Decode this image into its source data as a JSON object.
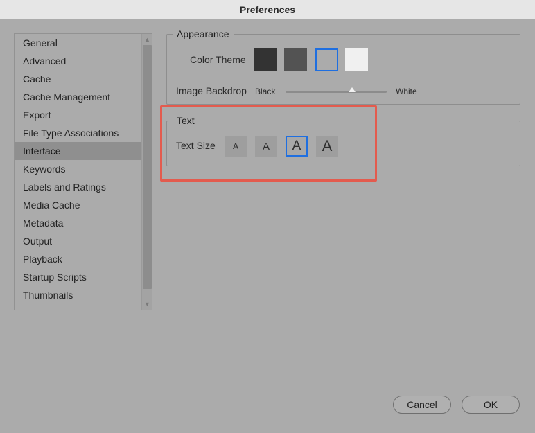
{
  "window": {
    "title": "Preferences"
  },
  "sidebar": {
    "items": [
      {
        "label": "General"
      },
      {
        "label": "Advanced"
      },
      {
        "label": "Cache"
      },
      {
        "label": "Cache Management"
      },
      {
        "label": "Export"
      },
      {
        "label": "File Type Associations"
      },
      {
        "label": "Interface",
        "selected": true
      },
      {
        "label": "Keywords"
      },
      {
        "label": "Labels and Ratings"
      },
      {
        "label": "Media Cache"
      },
      {
        "label": "Metadata"
      },
      {
        "label": "Output"
      },
      {
        "label": "Playback"
      },
      {
        "label": "Startup Scripts"
      },
      {
        "label": "Thumbnails"
      }
    ]
  },
  "appearance": {
    "legend": "Appearance",
    "color_theme_label": "Color Theme",
    "themes": [
      {
        "color": "#333333"
      },
      {
        "color": "#535353"
      },
      {
        "color": "#ababab",
        "selected": true
      },
      {
        "color": "#f0f0f0"
      }
    ],
    "image_backdrop_label": "Image Backdrop",
    "backdrop_min_label": "Black",
    "backdrop_max_label": "White",
    "backdrop_value": 0.66
  },
  "text": {
    "legend": "Text",
    "text_size_label": "Text Size",
    "sizes": [
      {
        "glyph": "A"
      },
      {
        "glyph": "A"
      },
      {
        "glyph": "A",
        "selected": true
      },
      {
        "glyph": "A"
      }
    ]
  },
  "footer": {
    "cancel_label": "Cancel",
    "ok_label": "OK"
  },
  "colors": {
    "accent": "#1f6fe0",
    "highlight": "#e35b4e"
  }
}
